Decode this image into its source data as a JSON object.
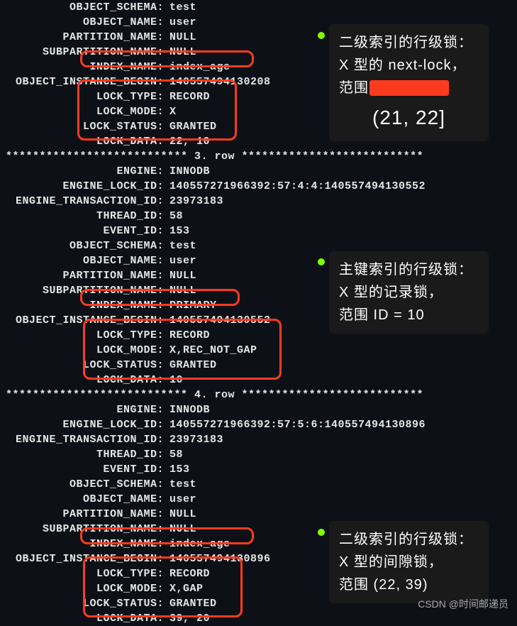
{
  "section1": {
    "object_schema": "test",
    "object_name": "user",
    "partition_name": "NULL",
    "subpartition_name": "NULL",
    "index_name": "index_age",
    "object_instance_begin": "140557494130208",
    "lock_type": "RECORD",
    "lock_mode": "X",
    "lock_status": "GRANTED",
    "lock_data": "22, 10"
  },
  "sep3": "*************************** 3. row ***************************",
  "section3": {
    "engine": "INNODB",
    "engine_lock_id": "140557271966392:57:4:4:140557494130552",
    "engine_transaction_id": "23973183",
    "thread_id": "58",
    "event_id": "153",
    "object_schema": "test",
    "object_name": "user",
    "partition_name": "NULL",
    "subpartition_name": "NULL",
    "index_name": "PRIMARY",
    "object_instance_begin": "140557494130552",
    "lock_type": "RECORD",
    "lock_mode": "X,REC_NOT_GAP",
    "lock_status": "GRANTED",
    "lock_data": "10"
  },
  "sep4": "*************************** 4. row ***************************",
  "section4": {
    "engine": "INNODB",
    "engine_lock_id": "140557271966392:57:5:6:140557494130896",
    "engine_transaction_id": "23973183",
    "thread_id": "58",
    "event_id": "153",
    "object_schema": "test",
    "object_name": "user",
    "partition_name": "NULL",
    "subpartition_name": "NULL",
    "index_name": "index_age",
    "object_instance_begin": "140557494130896",
    "lock_type": "RECORD",
    "lock_mode": "X,GAP",
    "lock_status": "GRANTED",
    "lock_data": "39, 20"
  },
  "labels": {
    "object_schema": "OBJECT_SCHEMA:",
    "object_name": "OBJECT_NAME:",
    "partition_name": "PARTITION_NAME:",
    "subpartition_name": "SUBPARTITION_NAME:",
    "index_name": "INDEX_NAME:",
    "object_instance_begin": "OBJECT_INSTANCE_BEGIN:",
    "lock_type": "LOCK_TYPE:",
    "lock_mode": "LOCK_MODE:",
    "lock_status": "LOCK_STATUS:",
    "lock_data": "LOCK_DATA:",
    "engine": "ENGINE:",
    "engine_lock_id": "ENGINE_LOCK_ID:",
    "engine_transaction_id": "ENGINE_TRANSACTION_ID:",
    "thread_id": "THREAD_ID:",
    "event_id": "EVENT_ID:"
  },
  "notes": {
    "n1": {
      "line1": "二级索引的行级锁：",
      "line2": "X 型的 next-lock，",
      "line3": "范围",
      "range": "(21, 22]"
    },
    "n2": {
      "line1": "主键索引的行级锁：",
      "line2": "X 型的记录锁，",
      "line3": "范围 ID = 10"
    },
    "n3": {
      "line1": "二级索引的行级锁：",
      "line2": "X 型的间隙锁，",
      "line3": "范围 (22, 39)"
    }
  },
  "watermark": "CSDN @时间邮递员"
}
